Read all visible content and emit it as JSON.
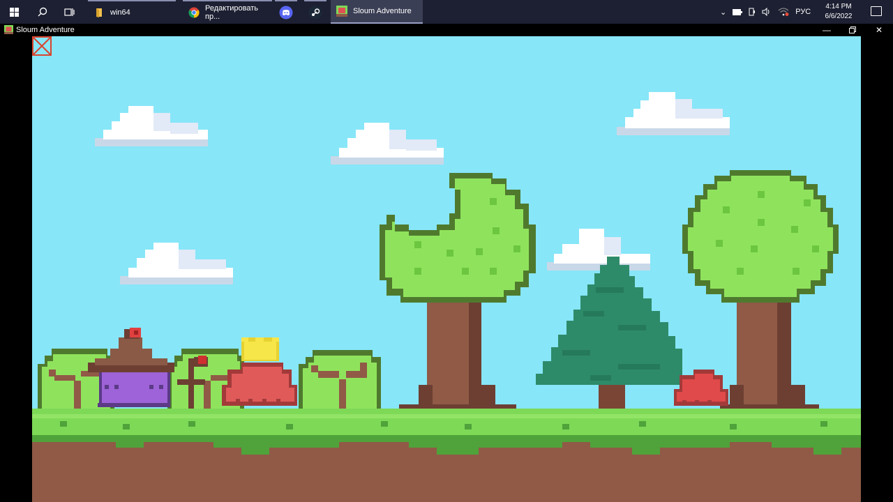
{
  "taskbar": {
    "apps": [
      {
        "label": "win64",
        "icon": "folder-icon"
      },
      {
        "label": "Редактировать пр...",
        "icon": "chrome-icon"
      },
      {
        "label": "",
        "icon": "discord-icon"
      },
      {
        "label": "",
        "icon": "steam-icon"
      },
      {
        "label": "Sloum Adventure",
        "icon": "game-icon"
      }
    ],
    "tray": {
      "language": "РУС",
      "time": "4:14 PM",
      "date": "6/6/2022"
    }
  },
  "window": {
    "title": "Sloum Adventure",
    "controls": [
      "minimize",
      "maximize",
      "close"
    ]
  },
  "game": {
    "sky_color": "#87e6f8",
    "grass_color": "#7ed957",
    "dirt_color": "#905a46",
    "close_button": "close-x-icon"
  }
}
